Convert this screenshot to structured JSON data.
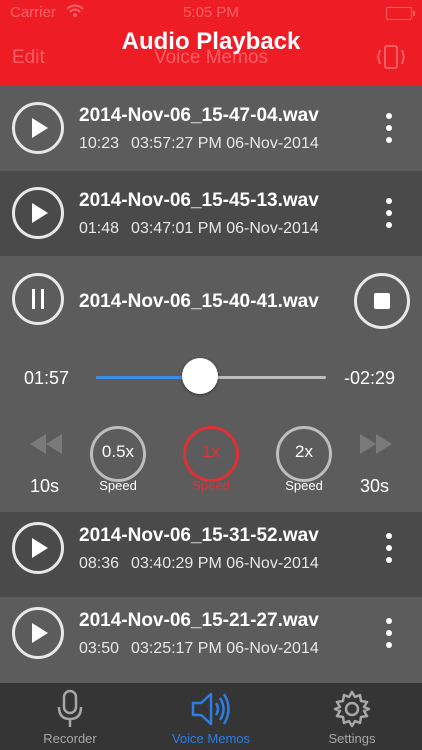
{
  "status_bar": {
    "carrier": "Carrier",
    "time": "5:05 PM"
  },
  "nav_bar": {
    "edit_label": "Edit",
    "title": "Voice Memos"
  },
  "header": {
    "title": "Audio Playback"
  },
  "recordings": [
    {
      "filename": "2014-Nov-06_15-47-04.wav",
      "duration": "10:23",
      "time": "03:57:27 PM",
      "date": "06-Nov-2014"
    },
    {
      "filename": "2014-Nov-06_15-45-13.wav",
      "duration": "01:48",
      "time": "03:47:01 PM",
      "date": "06-Nov-2014"
    },
    {
      "filename": "2014-Nov-06_15-40-41.wav"
    },
    {
      "filename": "2014-Nov-06_15-31-52.wav",
      "duration": "08:36",
      "time": "03:40:29 PM",
      "date": "06-Nov-2014"
    },
    {
      "filename": "2014-Nov-06_15-21-27.wav",
      "duration": "03:50",
      "time": "03:25:17 PM",
      "date": "06-Nov-2014"
    }
  ],
  "player": {
    "elapsed": "01:57",
    "remaining": "-02:29",
    "progress": 0.45,
    "skip_back_label": "10s",
    "skip_forward_label": "30s",
    "speeds": [
      {
        "value": "0.5x",
        "label": "Speed"
      },
      {
        "value": "1x",
        "label": "Speed"
      },
      {
        "value": "2x",
        "label": "Speed"
      }
    ],
    "selected_speed": "1x"
  },
  "tabs": [
    {
      "label": "Recorder"
    },
    {
      "label": "Voice Memos"
    },
    {
      "label": "Settings"
    }
  ],
  "colors": {
    "accent": "#ee1c24",
    "slider": "#3d8ee8",
    "tab_active": "#2f7de1",
    "speed_active": "#e03036"
  }
}
